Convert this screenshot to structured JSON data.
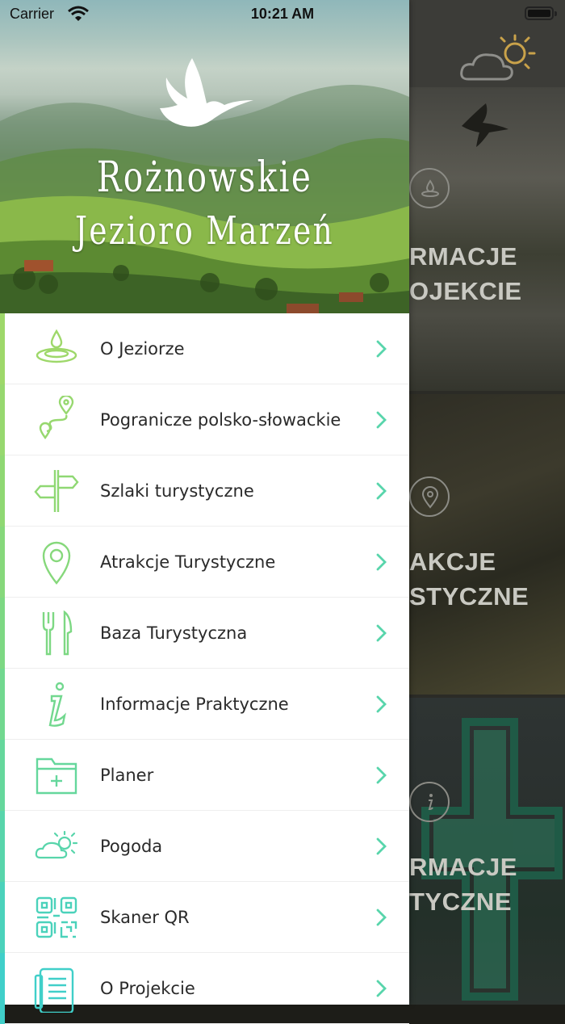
{
  "status_bar": {
    "carrier": "Carrier",
    "time": "10:21 AM"
  },
  "header": {
    "logo_line1": "Rożnowskie",
    "logo_line2": "Jezioro Marzeń"
  },
  "menu": {
    "items": [
      {
        "label": "O Jeziorze",
        "icon": "water-drop-icon",
        "bar_color": "#9ed86a"
      },
      {
        "label": "Pogranicze polsko-słowackie",
        "icon": "route-pins-icon",
        "bar_color": "#97d86f"
      },
      {
        "label": "Szlaki turystyczne",
        "icon": "signpost-icon",
        "bar_color": "#8fd873"
      },
      {
        "label": "Atrakcje Turystyczne",
        "icon": "location-pin-icon",
        "bar_color": "#86d87b"
      },
      {
        "label": "Baza Turystyczna",
        "icon": "fork-knife-icon",
        "bar_color": "#7dd883"
      },
      {
        "label": "Informacje Praktyczne",
        "icon": "info-icon",
        "bar_color": "#72d88f"
      },
      {
        "label": "Planer",
        "icon": "folder-plus-icon",
        "bar_color": "#65d79c"
      },
      {
        "label": "Pogoda",
        "icon": "weather-icon",
        "bar_color": "#58d5ab"
      },
      {
        "label": "Skaner QR",
        "icon": "qr-code-icon",
        "bar_color": "#4bd2bb"
      },
      {
        "label": "O Projekcie",
        "icon": "document-icon",
        "bar_color": "#40cfc9"
      }
    ]
  },
  "background_tiles": [
    {
      "line1": "RMACJE",
      "line2": "OJEKCIE",
      "icon": "water-drop-icon"
    },
    {
      "line1": "AKCJE",
      "line2": "STYCZNE",
      "icon": "location-pin-icon"
    },
    {
      "line1": "RMACJE",
      "line2": "TYCZNE",
      "icon": "info-icon"
    }
  ],
  "colors": {
    "chevron": "#4fd6b3",
    "icon_stroke_top": "#9ed86a",
    "icon_stroke_bottom": "#40cfc9"
  }
}
